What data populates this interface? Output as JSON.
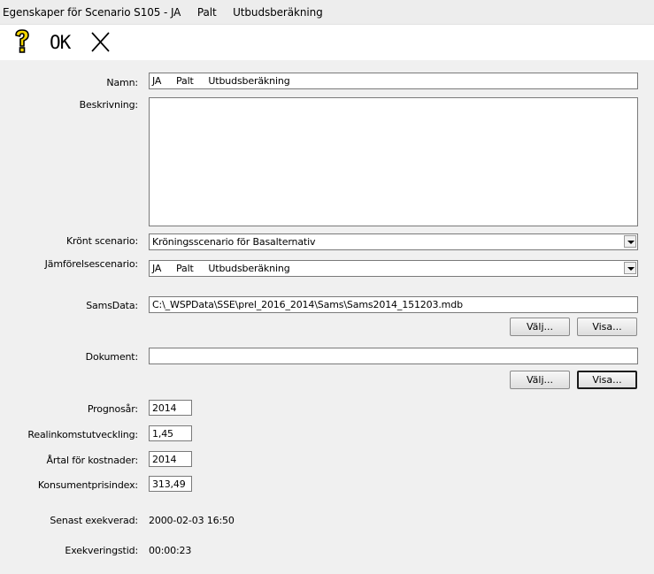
{
  "window": {
    "title": "Egenskaper för Scenario S105 - JA     Palt     Utbudsberäkning"
  },
  "toolbar": {
    "help_icon": "question-mark",
    "ok_label": "OK",
    "close_icon": "x-close"
  },
  "form": {
    "namn_label": "Namn:",
    "namn_value": "JA     Palt     Utbudsberäkning",
    "beskrivning_label": "Beskrivning:",
    "beskrivning_value": "",
    "kront_label": "Krönt scenario:",
    "kront_value": "Kröningsscenario för Basalternativ",
    "jamforelse_label": "Jämförelsescenario:",
    "jamforelse_value": "JA     Palt     Utbudsberäkning",
    "samsdata_label": "SamsData:",
    "samsdata_value": "C:\\_WSPData\\SSE\\prel_2016_2014\\Sams\\Sams2014_151203.mdb",
    "samsdata_valj": "Välj...",
    "samsdata_visa": "Visa...",
    "dokument_label": "Dokument:",
    "dokument_value": "",
    "dokument_valj": "Välj...",
    "dokument_visa": "Visa...",
    "prognosar_label": "Prognosår:",
    "prognosar_value": "2014",
    "realinkomst_label": "Realinkomstutveckling:",
    "realinkomst_value": "1,45",
    "artal_label": "Årtal för kostnader:",
    "artal_value": "2014",
    "kpi_label": "Konsumentprisindex:",
    "kpi_value": "313,49",
    "senast_label": "Senast exekverad:",
    "senast_value": "2000-02-03 16:50",
    "exekveringstid_label": "Exekveringstid:",
    "exekveringstid_value": "00:00:23"
  }
}
